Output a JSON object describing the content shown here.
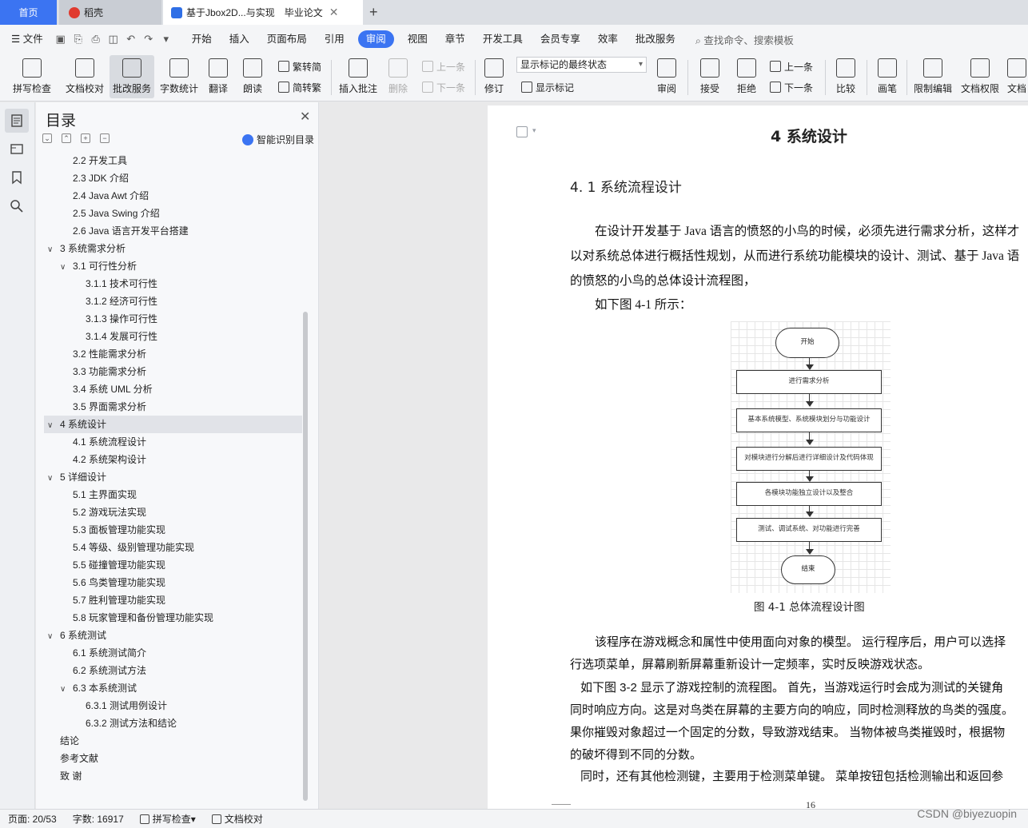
{
  "tabs": {
    "home": "首页",
    "daoke": "稻壳",
    "doc_title": "基于Jbox2D...与实现",
    "doc_tag": "毕业论文",
    "close": "✕",
    "add": "+"
  },
  "menu": {
    "file": "文件",
    "items": [
      "开始",
      "插入",
      "页面布局",
      "引用",
      "审阅",
      "视图",
      "章节",
      "开发工具",
      "会员专享",
      "效率",
      "批改服务"
    ],
    "active_index": 4,
    "search_placeholder": "查找命令、搜索模板"
  },
  "ribbon": {
    "spell_check": "拼写检查",
    "doc_proofread": "文档校对",
    "revise_service": "批改服务",
    "word_count": "字数统计",
    "translate": "翻译",
    "read_aloud": "朗读",
    "trad_to_simp": "繁转简",
    "simp_to_trad": "简转繁",
    "insert_comment": "插入批注",
    "delete": "删除",
    "prev": "上一条",
    "next": "下一条",
    "track_changes": "修订",
    "markup_state": "显示标记的最终状态",
    "show_markup": "显示标记",
    "review": "审阅",
    "accept": "接受",
    "reject": "拒绝",
    "prev2": "上一条",
    "next2": "下一条",
    "compare": "比较",
    "pen": "画笔",
    "restrict_edit": "限制编辑",
    "doc_permission": "文档权限",
    "doc_more": "文档"
  },
  "toc": {
    "title": "目录",
    "smart_toc": "智能识别目录",
    "items": [
      {
        "text": "2.2  开发工具",
        "level": 2,
        "toggle": ""
      },
      {
        "text": "2.3 JDK 介绍",
        "level": 2,
        "toggle": ""
      },
      {
        "text": "2.4 Java Awt 介绍",
        "level": 2,
        "toggle": ""
      },
      {
        "text": "2.5 Java Swing  介绍",
        "level": 2,
        "toggle": ""
      },
      {
        "text": "2.6 Java 语言开发平台搭建",
        "level": 2,
        "toggle": ""
      },
      {
        "text": "3 系统需求分析",
        "level": 1,
        "toggle": "∨"
      },
      {
        "text": "3.1  可行性分析",
        "level": 2,
        "toggle": "∨"
      },
      {
        "text": "3.1.1  技术可行性",
        "level": 3,
        "toggle": ""
      },
      {
        "text": "3.1.2  经济可行性",
        "level": 3,
        "toggle": ""
      },
      {
        "text": "3.1.3  操作可行性",
        "level": 3,
        "toggle": ""
      },
      {
        "text": "3.1.4  发展可行性",
        "level": 3,
        "toggle": ""
      },
      {
        "text": "3.2  性能需求分析",
        "level": 2,
        "toggle": ""
      },
      {
        "text": "3.3  功能需求分析",
        "level": 2,
        "toggle": ""
      },
      {
        "text": "3.4  系统 UML 分析",
        "level": 2,
        "toggle": ""
      },
      {
        "text": "3.5 界面需求分析",
        "level": 2,
        "toggle": ""
      },
      {
        "text": "4  系统设计",
        "level": 1,
        "toggle": "∨",
        "selected": true
      },
      {
        "text": "4.1 系统流程设计",
        "level": 2,
        "toggle": ""
      },
      {
        "text": "4.2  系统架构设计",
        "level": 2,
        "toggle": ""
      },
      {
        "text": "5  详细设计",
        "level": 1,
        "toggle": "∨"
      },
      {
        "text": "5.1  主界面实现",
        "level": 2,
        "toggle": ""
      },
      {
        "text": "5.2  游戏玩法实现",
        "level": 2,
        "toggle": ""
      },
      {
        "text": "5.3  面板管理功能实现",
        "level": 2,
        "toggle": ""
      },
      {
        "text": "5.4  等级、级别管理功能实现",
        "level": 2,
        "toggle": ""
      },
      {
        "text": "5.5  碰撞管理功能实现",
        "level": 2,
        "toggle": ""
      },
      {
        "text": "5.6  鸟类管理功能实现",
        "level": 2,
        "toggle": ""
      },
      {
        "text": "5.7  胜利管理功能实现",
        "level": 2,
        "toggle": ""
      },
      {
        "text": "5.8  玩家管理和备份管理功能实现",
        "level": 2,
        "toggle": ""
      },
      {
        "text": "6  系统测试",
        "level": 1,
        "toggle": "∨"
      },
      {
        "text": "6.1  系统测试简介",
        "level": 2,
        "toggle": ""
      },
      {
        "text": "6.2  系统测试方法",
        "level": 2,
        "toggle": ""
      },
      {
        "text": "6.3  本系统测试",
        "level": 2,
        "toggle": "∨"
      },
      {
        "text": "6.3.1  测试用例设计",
        "level": 3,
        "toggle": ""
      },
      {
        "text": "6.3.2  测试方法和结论",
        "level": 3,
        "toggle": ""
      },
      {
        "text": "结论",
        "level": 1,
        "toggle": ""
      },
      {
        "text": "参考文献",
        "level": 1,
        "toggle": ""
      },
      {
        "text": "致      谢",
        "level": 1,
        "toggle": ""
      }
    ]
  },
  "document": {
    "chapter_title": "4  系统设计",
    "section_title": "4. 1 系统流程设计",
    "para1": [
      "在设计开发基于 Java 语言的愤怒的小鸟的时候，必须先进行需求分析，这样才",
      "以对系统总体进行概括性规划，从而进行系统功能模块的设计、测试、基于 Java 语",
      "的愤怒的小鸟的总体设计流程图，",
      "如下图 4-1 所示："
    ],
    "flowchart": {
      "start": "开始",
      "steps": [
        "进行需求分析",
        "基本系统模型、系统模块划分与功能设计",
        "对模块进行分解后进行详细设计及代码体现",
        "各模块功能独立设计以及整合",
        "测试、调试系统、对功能进行完善"
      ],
      "end": "结束"
    },
    "figure_caption": "图 4-1  总体流程设计图",
    "para2": [
      "该程序在游戏概念和属性中使用面向对象的模型。 运行程序后，用户可以选择",
      "行选项菜单，屏幕刷新屏幕重新设计一定频率，实时反映游戏状态。",
      "如下图 3-2 显示了游戏控制的流程图。 首先，当游戏运行时会成为测试的关键角",
      "同时响应方向。这是对鸟类在屏幕的主要方向的响应，同时检测释放的鸟类的强度。",
      "果你摧毁对象超过一个固定的分数，导致游戏结束。 当物体被鸟类摧毁时，根据物",
      "的破坏得到不同的分数。",
      "同时，还有其他检测键，主要用于检测菜单键。 菜单按钮包括检测输出和返回参"
    ],
    "page_number": "16"
  },
  "status": {
    "page": "页面: 20/53",
    "words": "字数: 16917",
    "spell_check": "拼写检查",
    "doc_proofread": "文档校对"
  },
  "watermark": "CSDN @biyezuopin"
}
